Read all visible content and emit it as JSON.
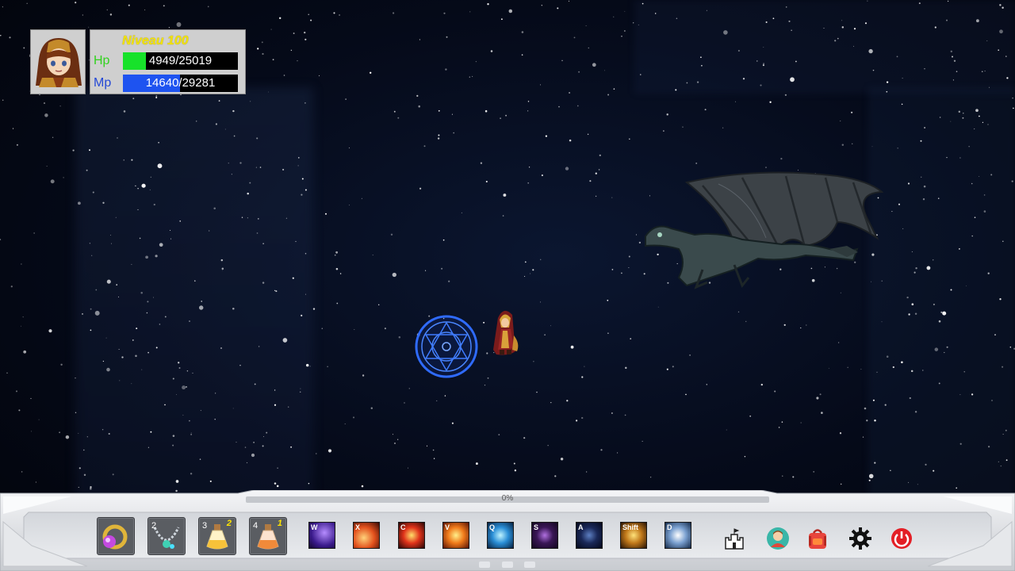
{
  "hud": {
    "level_text": "Niveau 100",
    "hp": {
      "label": "Hp",
      "current": 4949,
      "max": 25019,
      "text": "4949/25019",
      "color": "#17e22a"
    },
    "mp": {
      "label": "Mp",
      "current": 14640,
      "max": 29281,
      "text": "14640/29281",
      "color": "#1e53f0"
    }
  },
  "xp": {
    "percent_text": "0%",
    "value": 0
  },
  "items": [
    {
      "name": "gold-ring-icon",
      "count": "",
      "qty": ""
    },
    {
      "name": "silver-necklace-icon",
      "count": "2",
      "qty": ""
    },
    {
      "name": "yellow-potion-icon",
      "count": "3",
      "qty": "2"
    },
    {
      "name": "orange-potion-icon",
      "count": "4",
      "qty": "1"
    }
  ],
  "skills": [
    {
      "key": "W",
      "name": "purple-lightning-skill-icon"
    },
    {
      "key": "X",
      "name": "fire-meteor-skill-icon"
    },
    {
      "key": "C",
      "name": "fire-ring-skill-icon"
    },
    {
      "key": "V",
      "name": "flame-burst-skill-icon"
    },
    {
      "key": "Q",
      "name": "water-spiral-skill-icon"
    },
    {
      "key": "S",
      "name": "shadow-skill-icon"
    },
    {
      "key": "A",
      "name": "dark-aura-skill-icon"
    },
    {
      "key": "Shift",
      "name": "golden-strike-skill-icon"
    },
    {
      "key": "D",
      "name": "holy-guardian-skill-icon"
    }
  ],
  "menu": [
    {
      "name": "castle-icon"
    },
    {
      "name": "character-icon"
    },
    {
      "name": "backpack-icon"
    },
    {
      "name": "gear-icon"
    },
    {
      "name": "power-icon"
    }
  ],
  "colors": {
    "hp_fill": "#17e22a",
    "mp_fill": "#1e53f0",
    "level_text": "#f2e30b",
    "magic_circle": "#2f6bff"
  }
}
